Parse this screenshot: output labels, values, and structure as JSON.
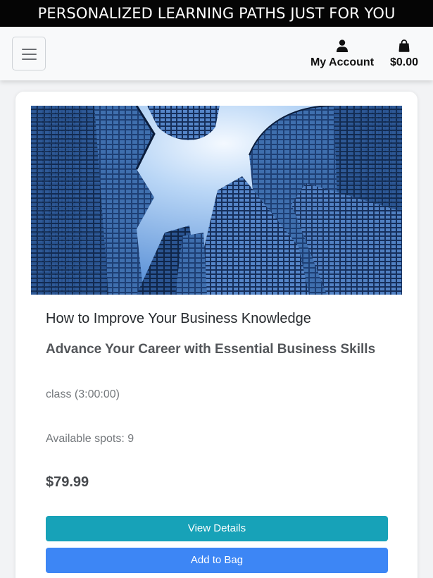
{
  "banner": {
    "text": "PERSONALIZED LEARNING PATHS JUST FOR YOU"
  },
  "navbar": {
    "menu_icon": "hamburger-icon",
    "account": {
      "icon": "user-icon",
      "label": "My Account"
    },
    "bag": {
      "icon": "shopping-bag-icon",
      "total": "$0.00"
    }
  },
  "course": {
    "image": "glass-skyscrapers-looking-up",
    "title": "How to Improve Your Business Knowledge",
    "subtitle": "Advance Your Career with Essential Business Skills",
    "type": "class (3:00:00)",
    "spots": "Available spots: 9",
    "price": "$79.99",
    "view_details_label": "View Details",
    "add_to_bag_label": "Add to Bag"
  },
  "colors": {
    "banner_bg": "#050505",
    "view_details": "#17a2b8",
    "add_to_bag": "#3d86f5"
  }
}
